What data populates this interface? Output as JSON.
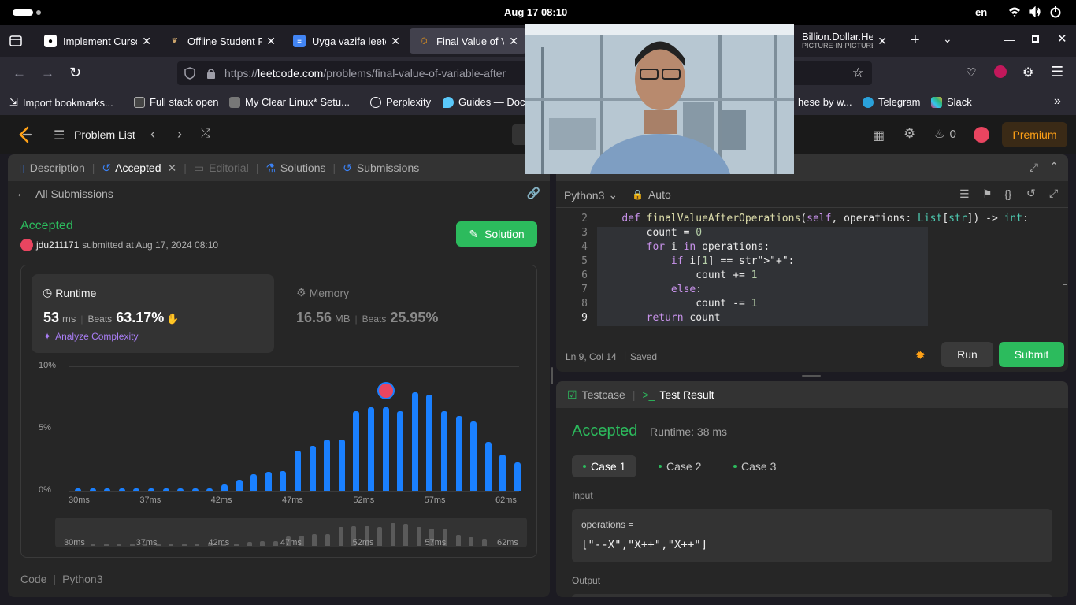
{
  "system": {
    "clock": "Aug 17  08:10",
    "lang": "en"
  },
  "tabs": [
    {
      "title": "Implement Cursor",
      "icon": "github-icon"
    },
    {
      "title": "Offline Student P",
      "icon": "bird-icon"
    },
    {
      "title": "Uyga vazifa leetc",
      "icon": "doc-icon"
    },
    {
      "title": "Final Value of Va",
      "icon": "leetcode-icon",
      "active": true
    },
    {
      "title": "Billion.Dollar.Hei",
      "subtitle": "PICTURE-IN-PICTURE",
      "icon": "pip-icon"
    }
  ],
  "url": {
    "prefix": "https://",
    "host": "leetcode.com",
    "path": "/problems/final-value-of-variable-after"
  },
  "bookmarks": [
    {
      "label": "Import bookmarks..."
    },
    {
      "label": "Full stack open"
    },
    {
      "label": "My Clear Linux* Setu..."
    },
    {
      "label": "Perplexity"
    },
    {
      "label": "Guides — Docu"
    },
    {
      "label": "hese by w..."
    },
    {
      "label": "Telegram"
    },
    {
      "label": "Slack"
    }
  ],
  "lcnav": {
    "problem_list": "Problem List",
    "streak": "0",
    "premium": "Premium"
  },
  "left_tabs": {
    "description": "Description",
    "accepted": "Accepted",
    "editorial": "Editorial",
    "solutions": "Solutions",
    "submissions": "Submissions"
  },
  "submission": {
    "back": "All Submissions",
    "status": "Accepted",
    "user": "jdu211171",
    "submitted": "submitted at Aug 17, 2024 08:10",
    "solution_btn": "Solution",
    "runtime_label": "Runtime",
    "runtime_value": "53",
    "runtime_unit": "ms",
    "beats_label": "Beats",
    "runtime_beats": "63.17%",
    "analyze": "Analyze Complexity",
    "memory_label": "Memory",
    "memory_value": "16.56",
    "memory_unit": "MB",
    "memory_beats": "25.95%",
    "code_label": "Code",
    "code_lang": "Python3"
  },
  "chart_data": {
    "type": "bar",
    "title": "",
    "xlabel": "",
    "ylabel": "",
    "ylim": [
      0,
      10
    ],
    "yticks": [
      "0%",
      "5%",
      "10%"
    ],
    "xticks": [
      "30ms",
      "37ms",
      "42ms",
      "47ms",
      "52ms",
      "57ms",
      "62ms"
    ],
    "values": [
      0.2,
      0.2,
      0.2,
      0.2,
      0.2,
      0.2,
      0.2,
      0.2,
      0.2,
      0.2,
      0.5,
      0.9,
      1.3,
      1.5,
      1.6,
      3.2,
      3.6,
      4.1,
      4.1,
      6.4,
      6.7,
      6.7,
      6.4,
      7.9,
      7.7,
      6.4,
      6.0,
      5.6,
      3.9,
      2.9,
      2.3
    ],
    "highlight_index": 21
  },
  "editor": {
    "lang": "Python3",
    "mode": "Auto",
    "status_pos": "Ln 9, Col 14",
    "status_saved": "Saved",
    "run": "Run",
    "submit": "Submit",
    "lines": [
      {
        "n": "2",
        "code": "    def finalValueAfterOperations(self, operations: List[str]) -> int:"
      },
      {
        "n": "3",
        "code": "        count = 0"
      },
      {
        "n": "4",
        "code": "        for i in operations:"
      },
      {
        "n": "5",
        "code": "            if i[1] == \"+\":"
      },
      {
        "n": "6",
        "code": "                count += 1"
      },
      {
        "n": "7",
        "code": "            else:"
      },
      {
        "n": "8",
        "code": "                count -= 1"
      },
      {
        "n": "9",
        "code": "        return count"
      }
    ]
  },
  "testpanel": {
    "testcase_tab": "Testcase",
    "result_tab": "Test Result",
    "status": "Accepted",
    "runtime": "Runtime: 38 ms",
    "cases": [
      "Case 1",
      "Case 2",
      "Case 3"
    ],
    "input_label": "Input",
    "input_var": "operations =",
    "input_value": "[\"--X\",\"X++\",\"X++\"]",
    "output_label": "Output"
  }
}
